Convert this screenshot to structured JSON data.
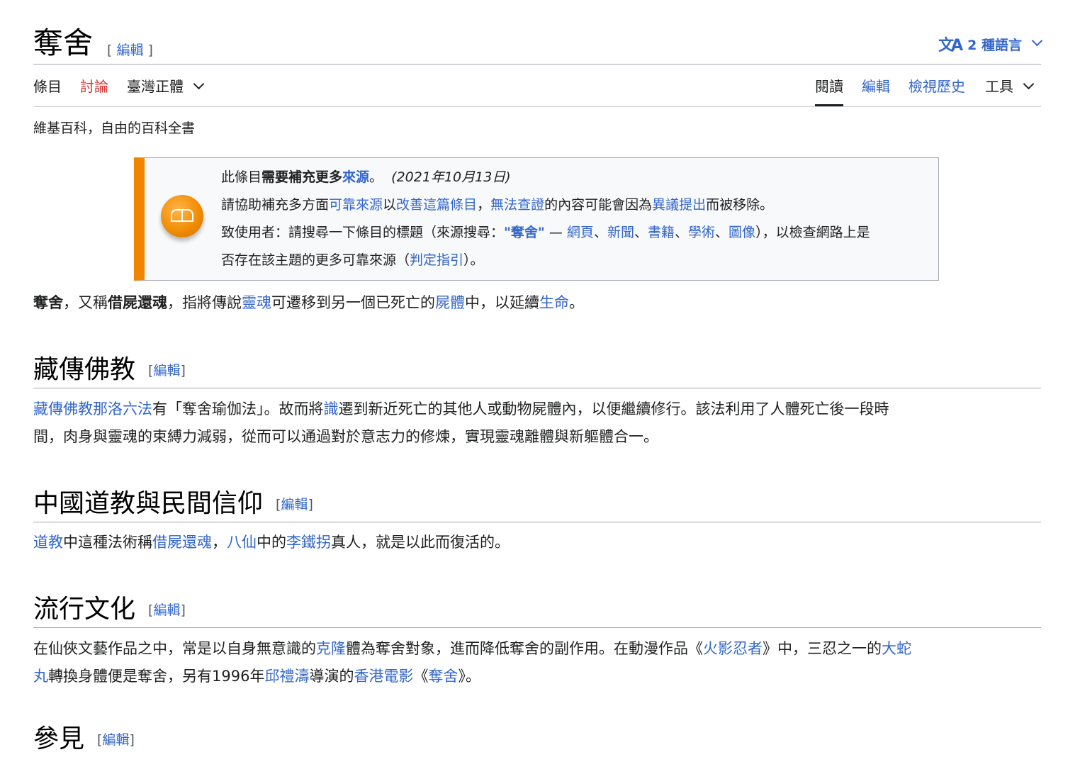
{
  "article": {
    "title": "奪舍",
    "edit": "編輯",
    "bracket_open": "[",
    "bracket_close": "]",
    "languages_label": "2 種語言",
    "tagline": "維基百科，自由的百科全書"
  },
  "tabs": {
    "left": [
      "條目",
      "討論",
      "臺灣正體"
    ],
    "right": [
      "閱讀",
      "編輯",
      "檢視歷史",
      "工具"
    ]
  },
  "ambox": {
    "l1": [
      "此條目",
      "需要補充更多",
      "來源",
      "。",
      "(2021年10月13日)"
    ],
    "l2": [
      "請協助補充多方面",
      "可靠來源",
      "以",
      "改善這篇條目",
      "，",
      "無法查證",
      "的內容可能會因為",
      "異議提出",
      "而被移除。"
    ],
    "l3": [
      "致使用者：請搜尋一下條目的標題（來源搜尋：",
      "\"奪舍\"",
      " — ",
      "網頁",
      "、",
      "新聞",
      "、",
      "書籍",
      "、",
      "學術",
      "、",
      "圖像",
      "），以檢查網路上是"
    ],
    "l4": [
      "否存在該主題的更多可靠來源（",
      "判定指引",
      "）。"
    ]
  },
  "intro": [
    "奪舍",
    "，又稱",
    "借屍還魂",
    "，指將傳說",
    "靈魂",
    "可遷移到另一個已死亡的",
    "屍體",
    "中，以延續",
    "生命",
    "。"
  ],
  "sections": [
    {
      "title": "藏傳佛教",
      "parts": [
        "藏傳佛教那洛六法",
        "有「奪舍瑜伽法」。故而將",
        "識",
        "遷到新近死亡的其他人或動物屍體內，以便繼續修行。該法利用了人體死亡後一段時",
        "間，肉身與靈魂的束縛力減弱，從而可以通過對於意志力的修煉，實現靈魂離體與新軀體合一。"
      ]
    },
    {
      "title": "中國道教與民間信仰",
      "parts": [
        "道教",
        "中這種法術稱",
        "借屍還魂",
        "，",
        "八仙",
        "中的",
        "李鐵拐",
        "真人，就是以此而復活的。"
      ]
    },
    {
      "title": "流行文化",
      "parts": [
        "在仙俠文藝作品之中，常是以自身無意識的",
        "克隆",
        "體為奪舍對象，進而降低奪舍的副作用。在動漫作品《",
        "火影忍者",
        "》中，三忍之一的",
        "大蛇",
        "丸",
        "轉換身體便是奪舍，另有1996年",
        "邱禮濤",
        "導演的",
        "香港電影",
        "《",
        "奪舍",
        "》。"
      ]
    },
    {
      "title": "參見"
    }
  ],
  "colors": {
    "link": "#3366cc",
    "redlink": "#d73333",
    "ambox_accent": "#f28500"
  },
  "icons": [
    "translate-icon",
    "chevron-down-icon",
    "book-icon"
  ]
}
